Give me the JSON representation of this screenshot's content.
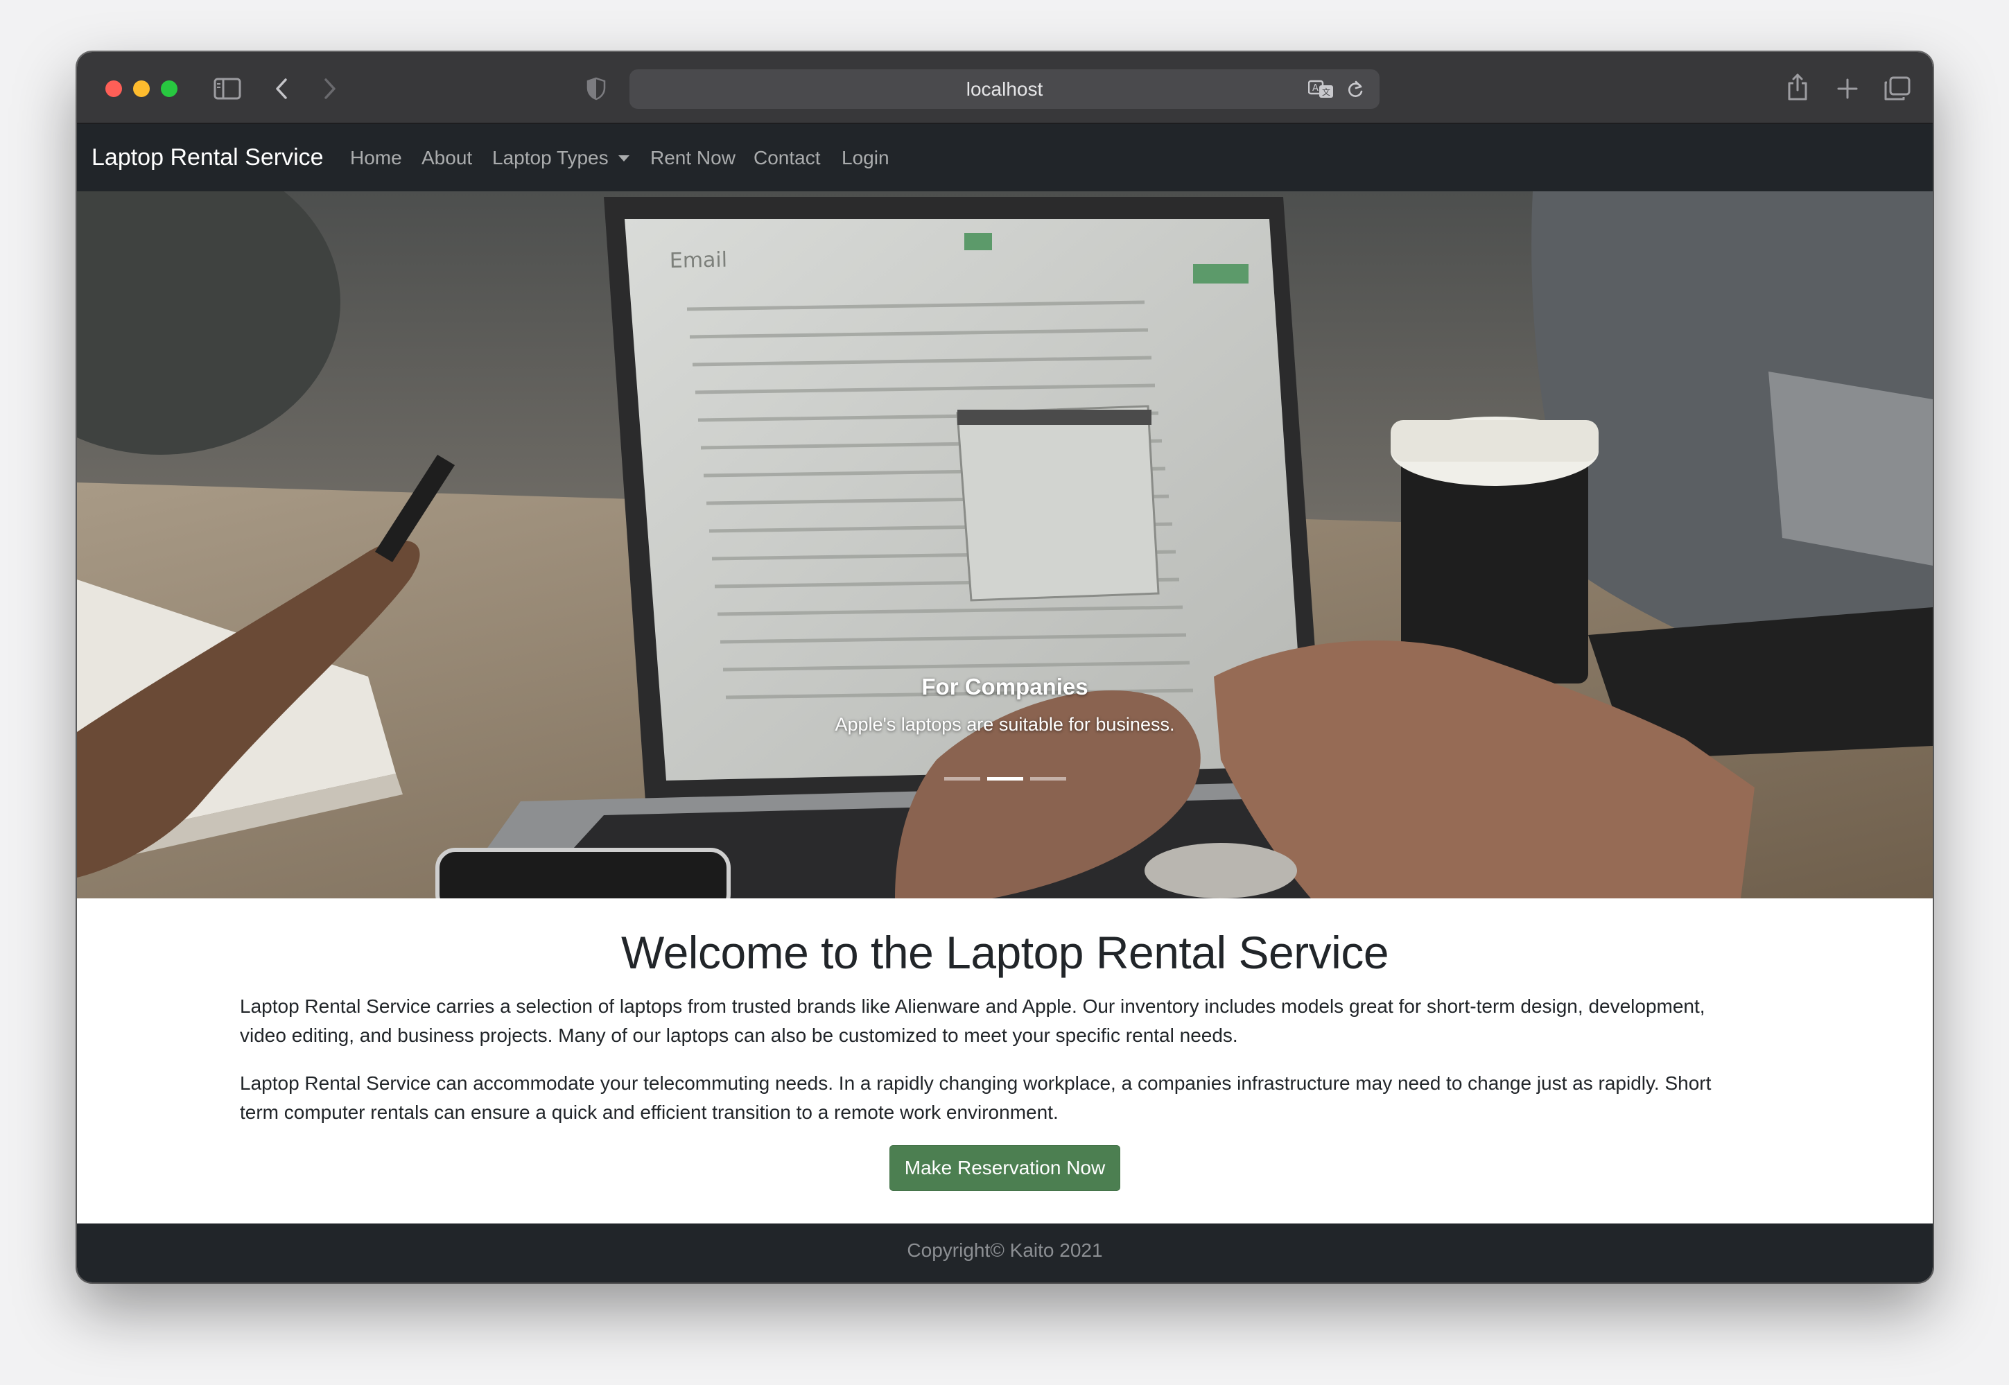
{
  "browser": {
    "url": "localhost"
  },
  "navbar": {
    "brand": "Laptop Rental Service",
    "links": [
      {
        "label": "Home"
      },
      {
        "label": "About"
      },
      {
        "label": "Laptop Types"
      },
      {
        "label": "Rent Now"
      },
      {
        "label": "Contact"
      },
      {
        "label": "Login"
      }
    ]
  },
  "carousel": {
    "screen_title": "Email",
    "caption_title": "For Companies",
    "caption_text": "Apple's laptops are suitable for business.",
    "slide_count": 3,
    "active_slide": 2
  },
  "main": {
    "headline": "Welcome to the Laptop Rental Service",
    "paragraphs": [
      "Laptop Rental Service carries a selection of laptops from trusted brands like Alienware and Apple. Our inventory includes models great for short-term design, development, video editing, and business projects. Many of our laptops can also be customized to meet your specific rental needs.",
      "Laptop Rental Service can accommodate your telecommuting needs. In a rapidly changing workplace, a companies infrastructure may need to change just as rapidly. Short term computer rentals can ensure a quick and efficient transition to a remote work environment."
    ],
    "cta_label": "Make Reservation Now"
  },
  "footer": {
    "text": "Copyright© Kaito 2021"
  },
  "colors": {
    "navbar_bg": "#212529",
    "cta_bg": "#4c7f51",
    "browser_chrome": "#38383a"
  },
  "icons": {
    "toolbar_left": [
      "sidebar-icon",
      "back-chevron-icon",
      "forward-chevron-icon",
      "privacy-shield-icon"
    ],
    "urlbar_right": [
      "translate-icon",
      "reload-icon"
    ],
    "toolbar_right": [
      "share-icon",
      "new-tab-plus-icon",
      "tab-overview-icon"
    ]
  }
}
